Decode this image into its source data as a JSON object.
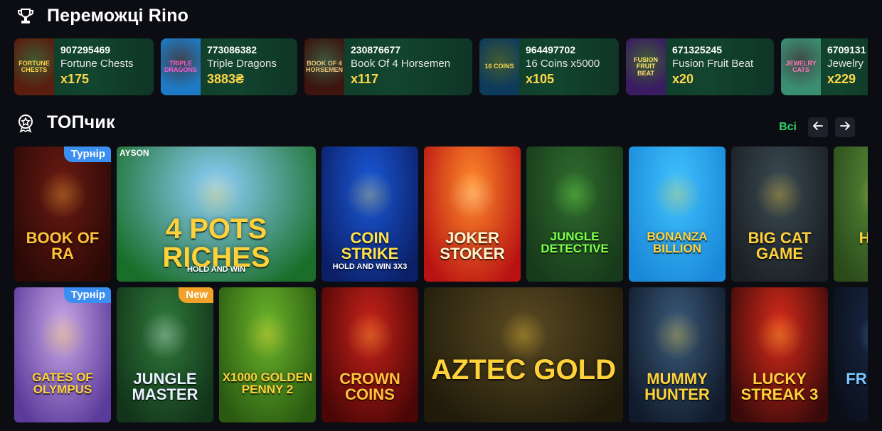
{
  "winners": {
    "title": "Переможці Rino",
    "items": [
      {
        "id": "907295469",
        "game": "Fortune Chests",
        "amount": "x175",
        "thumb": "Fortune Chests",
        "width": 196,
        "bg": "#5a1d0f",
        "fg": "#ffcf4a"
      },
      {
        "id": "773086382",
        "game": "Triple Dragons",
        "amount": "3883₴",
        "thumb": "Triple Dragons",
        "width": 192,
        "bg": "#1e7ac4",
        "fg": "#ff5ad1"
      },
      {
        "id": "230876677",
        "game": "Book Of 4 Horsemen",
        "amount": "x117",
        "thumb": "Book of 4 Horsemen",
        "width": 236,
        "bg": "#3d1410",
        "fg": "#e7c27a"
      },
      {
        "id": "964497702",
        "game": "16 Coins x5000",
        "amount": "x105",
        "thumb": "16 Coins",
        "width": 196,
        "bg": "#0e3a5c",
        "fg": "#ffd84a"
      },
      {
        "id": "671325245",
        "game": "Fusion Fruit Beat",
        "amount": "x20",
        "thumb": "Fusion Fruit Beat",
        "width": 208,
        "bg": "#3a1c62",
        "fg": "#ffe066"
      },
      {
        "id": "6709131",
        "game": "Jewelry",
        "amount": "x229",
        "thumb": "Jewelry Cats",
        "width": 150,
        "bg": "#3a8f73",
        "fg": "#ff76b8"
      }
    ]
  },
  "top": {
    "title": "ТОПчик",
    "all_label": "Всі",
    "prev_icon": "arrow-left-icon",
    "next_icon": "arrow-right-icon"
  },
  "games": [
    {
      "title": "Book of Ra",
      "badge": "Турнір",
      "badge_type": "tour",
      "c1": "#6a1a12",
      "c2": "#2a0906",
      "tc": "#ffc23a",
      "row": 0,
      "col": 0,
      "cw": 1
    },
    {
      "title": "4 Pots Riches",
      "sub": "Hold and Win",
      "label": "AYSON",
      "c1": "#8fd1ff",
      "c2": "#1b6e2a",
      "tc": "#ffd23a",
      "row": 0,
      "col": 1,
      "cw": 2
    },
    {
      "title": "Coin Strike",
      "sub": "Hold and Win 3x3",
      "c1": "#1a58d8",
      "c2": "#0b1f66",
      "tc": "#ffe14a",
      "row": 0,
      "col": 3,
      "cw": 1
    },
    {
      "title": "Joker Stoker",
      "c1": "#ff8b2a",
      "c2": "#b81212",
      "tc": "#fff3d0",
      "row": 0,
      "col": 4,
      "cw": 1
    },
    {
      "title": "Jungle Detective",
      "c1": "#2f6b2e",
      "c2": "#173a1a",
      "tc": "#7dff4a",
      "row": 0,
      "col": 5,
      "cw": 1
    },
    {
      "title": "Bonanza Billion",
      "c1": "#3fc2ff",
      "c2": "#1a88d8",
      "tc": "#ffd23a",
      "row": 0,
      "col": 6,
      "cw": 1
    },
    {
      "title": "Big Cat Game",
      "c1": "#3b4a52",
      "c2": "#1a1f24",
      "tc": "#ffd23a",
      "row": 0,
      "col": 7,
      "cw": 1
    },
    {
      "title": "Hung",
      "c1": "#5a8f3a",
      "c2": "#2a4a1a",
      "tc": "#ffd23a",
      "row": 0,
      "col": 8,
      "cw": 1
    },
    {
      "title": "Gates of Olympus",
      "badge": "Турнір",
      "badge_type": "tour",
      "c1": "#c9a7e8",
      "c2": "#5a3a9a",
      "tc": "#ffd23a",
      "row": 1,
      "col": 0,
      "cw": 1
    },
    {
      "title": "Jungle Master",
      "badge": "New",
      "badge_type": "new",
      "c1": "#2f7a3a",
      "c2": "#12341a",
      "tc": "#e8f0ff",
      "row": 1,
      "col": 1,
      "cw": 1
    },
    {
      "title": "x1000 Golden Penny 2",
      "c1": "#6ab42a",
      "c2": "#2a5a12",
      "tc": "#ffd23a",
      "row": 1,
      "col": 2,
      "cw": 1
    },
    {
      "title": "Crown Coins",
      "c1": "#c8221a",
      "c2": "#4a0606",
      "tc": "#ffc23a",
      "row": 1,
      "col": 3,
      "cw": 1
    },
    {
      "title": "Aztec Gold",
      "c1": "#5a4a22",
      "c2": "#1f1a0a",
      "tc": "#ffd23a",
      "row": 1,
      "col": 4,
      "cw": 2
    },
    {
      "title": "Mummy Hunter",
      "c1": "#3a5a7a",
      "c2": "#101a2a",
      "tc": "#ffd23a",
      "row": 1,
      "col": 6,
      "cw": 1
    },
    {
      "title": "Lucky Streak 3",
      "c1": "#d82a1a",
      "c2": "#3a0a0a",
      "tc": "#ffd23a",
      "row": 1,
      "col": 7,
      "cw": 1
    },
    {
      "title": "Fr the B",
      "c1": "#1a2a4a",
      "c2": "#0a0f1a",
      "tc": "#7ac8ff",
      "row": 1,
      "col": 8,
      "cw": 1
    }
  ]
}
